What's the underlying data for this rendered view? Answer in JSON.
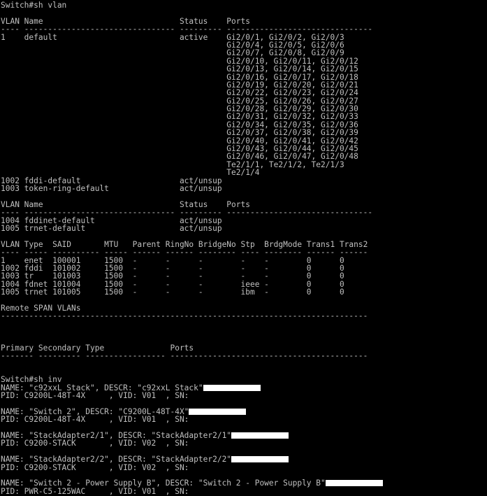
{
  "terminal": {
    "lines": [
      "Switch#sh vlan",
      "",
      "VLAN Name                             Status    Ports",
      "---- -------------------------------- --------- -------------------------------",
      "1    default                          active    Gi2/0/1, Gi2/0/2, Gi2/0/3",
      "                                                Gi2/0/4, Gi2/0/5, Gi2/0/6",
      "                                                Gi2/0/7, Gi2/0/8, Gi2/0/9",
      "                                                Gi2/0/10, Gi2/0/11, Gi2/0/12",
      "                                                Gi2/0/13, Gi2/0/14, Gi2/0/15",
      "                                                Gi2/0/16, Gi2/0/17, Gi2/0/18",
      "                                                Gi2/0/19, Gi2/0/20, Gi2/0/21",
      "                                                Gi2/0/22, Gi2/0/23, Gi2/0/24",
      "                                                Gi2/0/25, Gi2/0/26, Gi2/0/27",
      "                                                Gi2/0/28, Gi2/0/29, Gi2/0/30",
      "                                                Gi2/0/31, Gi2/0/32, Gi2/0/33",
      "                                                Gi2/0/34, Gi2/0/35, Gi2/0/36",
      "                                                Gi2/0/37, Gi2/0/38, Gi2/0/39",
      "                                                Gi2/0/40, Gi2/0/41, Gi2/0/42",
      "                                                Gi2/0/43, Gi2/0/44, Gi2/0/45",
      "                                                Gi2/0/46, Gi2/0/47, Gi2/0/48",
      "                                                Te2/1/1, Te2/1/2, Te2/1/3",
      "                                                Te2/1/4",
      "1002 fddi-default                     act/unsup",
      "1003 token-ring-default               act/unsup",
      "",
      "VLAN Name                             Status    Ports",
      "---- -------------------------------- --------- -------------------------------",
      "1004 fddinet-default                  act/unsup",
      "1005 trnet-default                    act/unsup",
      "",
      "VLAN Type  SAID       MTU   Parent RingNo BridgeNo Stp  BrdgMode Trans1 Trans2",
      "---- ----- ---------- ----- ------ ------ -------- ---- -------- ------ ------",
      "1    enet  100001     1500  -      -      -        -    -        0      0",
      "1002 fddi  101002     1500  -      -      -        -    -        0      0",
      "1003 tr    101003     1500  -      -      -        -    -        0      0",
      "1004 fdnet 101004     1500  -      -      -        ieee -        0      0",
      "1005 trnet 101005     1500  -      -      -        ibm  -        0      0",
      "",
      "Remote SPAN VLANs",
      "------------------------------------------------------------------------------",
      "",
      "",
      "",
      "Primary Secondary Type              Ports",
      "------- --------- ----------------- ------------------------------------------",
      "",
      "",
      "Switch#sh inv",
      "NAME: \"c92xxL Stack\", DESCR: \"c92xxL Stack\"",
      "PID: C9200L-48T-4X     , VID: V01  , SN: ",
      "",
      "NAME: \"Switch 2\", DESCR: \"C9200L-48T-4X\"",
      "PID: C9200L-48T-4X     , VID: V01  , SN: ",
      "",
      "NAME: \"StackAdapter2/1\", DESCR: \"StackAdapter2/1\"",
      "PID: C9200-STACK       , VID: V02  , SN: ",
      "",
      "NAME: \"StackAdapter2/2\", DESCR: \"StackAdapter2/2\"",
      "PID: C9200-STACK       , VID: V02  , SN: ",
      "",
      "NAME: \"Switch 2 - Power Supply B\", DESCR: \"Switch 2 - Power Supply B\"",
      "PID: PWR-C5-125WAC     , VID: V01  , SN: "
    ],
    "redacted_line_indexes": [
      48,
      51,
      54,
      57,
      60
    ],
    "colors": {
      "background": "#000000",
      "text": "#c0c0c0",
      "redaction": "#ffffff"
    }
  }
}
